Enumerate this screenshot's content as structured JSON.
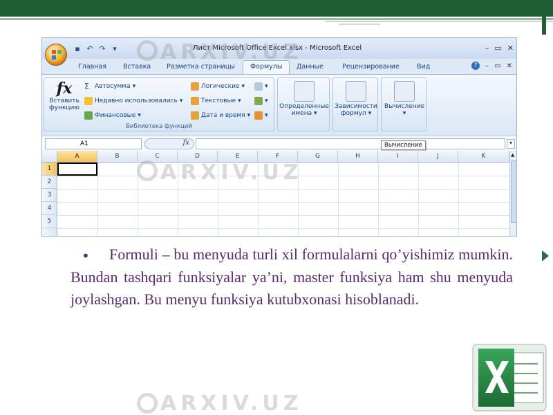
{
  "excel": {
    "window_title": "Лист Microsoft Office Excel.xlsx - Microsoft Excel",
    "tabs": [
      "Главная",
      "Вставка",
      "Разметка страницы",
      "Формулы",
      "Данные",
      "Рецензирование",
      "Вид"
    ],
    "active_tab": "Формулы",
    "ribbon": {
      "insert_function": [
        "Вставить",
        "функцию"
      ],
      "fx_symbol": "fx",
      "library_items": [
        {
          "label": "Автосумма",
          "icon": "sigma-icon"
        },
        {
          "label": "Недавно использовались",
          "icon": "star-icon"
        },
        {
          "label": "Финансовые",
          "icon": "coin-icon"
        },
        {
          "label": "Логические",
          "icon": "book-icon"
        },
        {
          "label": "Текстовые",
          "icon": "book-icon"
        },
        {
          "label": "Дата и время",
          "icon": "book-icon"
        }
      ],
      "library_group_label": "Библиотека функций",
      "defined_names": [
        "Определенные",
        "имена"
      ],
      "dependencies": [
        "Зависимости",
        "формул"
      ],
      "calculation": "Вычисление"
    },
    "name_box": "A1",
    "fx_label": "fx",
    "tooltip": "Вычисление",
    "columns": [
      "A",
      "B",
      "C",
      "D",
      "E",
      "F",
      "G",
      "H",
      "I",
      "J",
      "K"
    ],
    "rows": [
      "1",
      "2",
      "3",
      "4",
      "5"
    ]
  },
  "bullet": "•",
  "body_text": "Formuli – bu menyuda turli xil formulalarni qo’yishimiz mumkin. Bundan tashqari funksiyalar ya’ni, master funksiya ham shu menyuda joylashgan. Bu menyu funksiya kutubxonasi hisoblanadi.",
  "watermark": "ARXIV.UZ",
  "colors": {
    "slide_green": "#1e5f33",
    "text_purple": "#5b2a6e",
    "excel_green": "#1f7a3b"
  }
}
